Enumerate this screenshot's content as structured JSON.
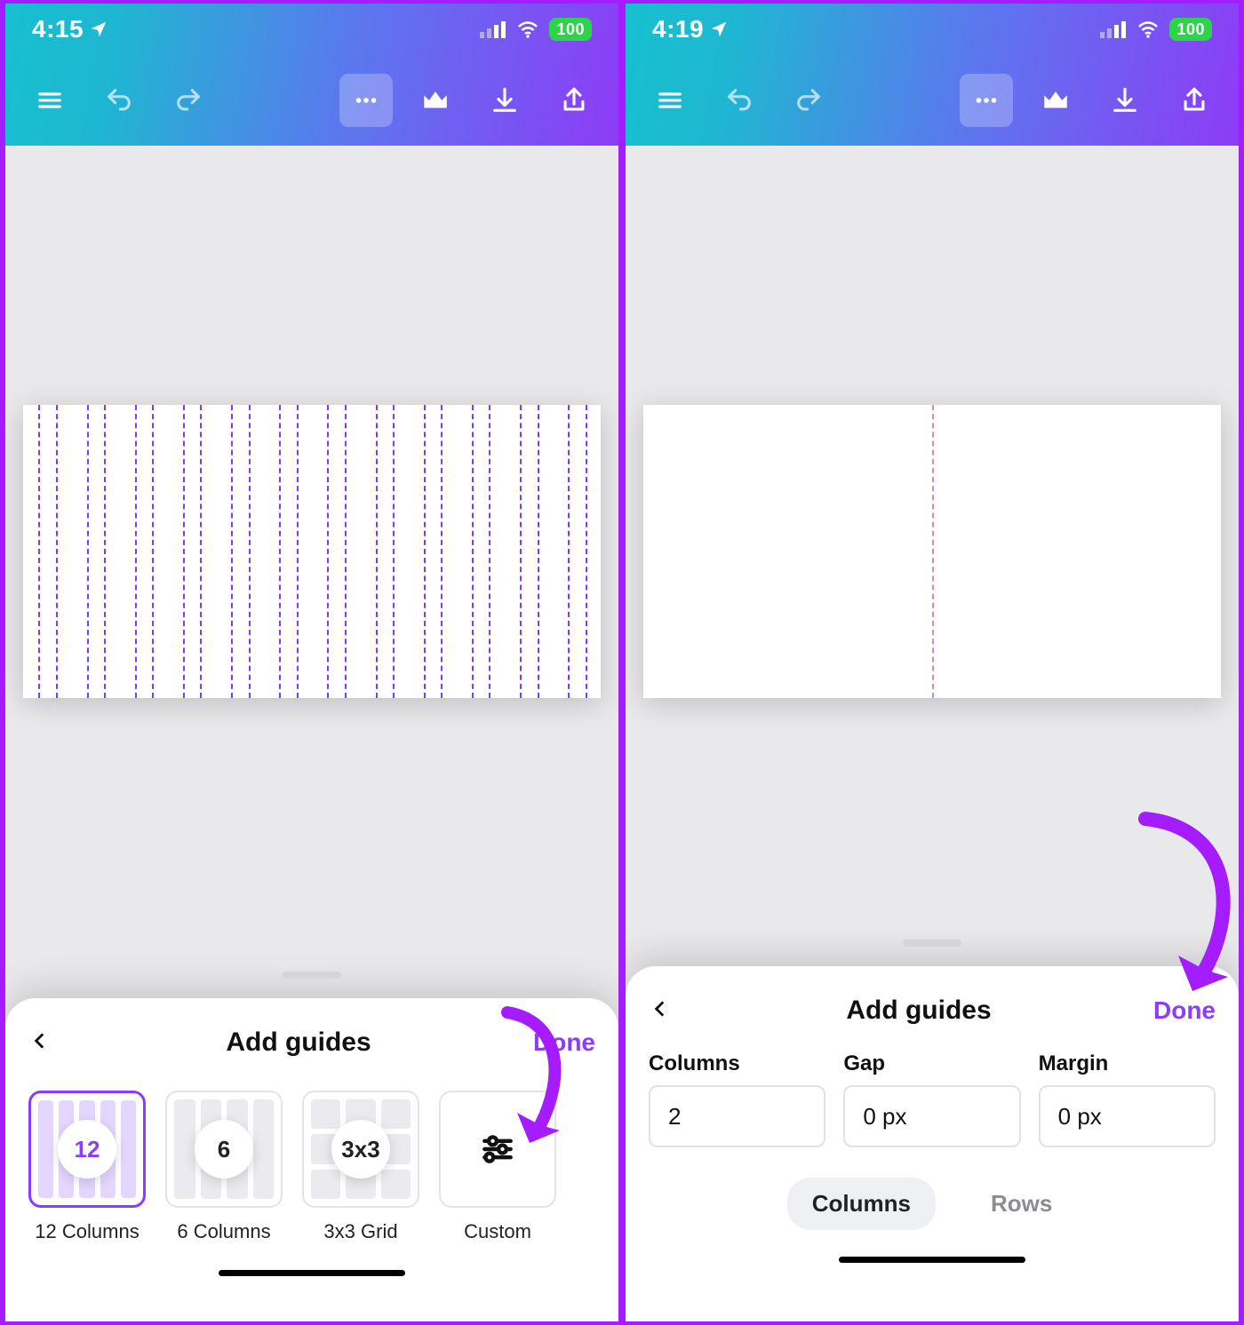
{
  "left": {
    "status": {
      "time": "4:15",
      "battery": "100"
    },
    "sheet": {
      "title": "Add guides",
      "done": "Done",
      "options": [
        {
          "badge": "12",
          "label": "12 Columns",
          "type": "cols",
          "cols": 5,
          "selected": true
        },
        {
          "badge": "6",
          "label": "6 Columns",
          "type": "cols",
          "cols": 4,
          "selected": false
        },
        {
          "badge": "3x3",
          "label": "3x3 Grid",
          "type": "grid",
          "selected": false
        },
        {
          "badge": "",
          "label": "Custom",
          "type": "custom",
          "selected": false
        }
      ]
    }
  },
  "right": {
    "status": {
      "time": "4:19",
      "battery": "100"
    },
    "sheet": {
      "title": "Add guides",
      "done": "Done",
      "fields": {
        "columns": {
          "label": "Columns",
          "value": "2"
        },
        "gap": {
          "label": "Gap",
          "value": "0 px"
        },
        "margin": {
          "label": "Margin",
          "value": "0 px"
        }
      },
      "segmented": {
        "columns": "Columns",
        "rows": "Rows"
      }
    }
  }
}
